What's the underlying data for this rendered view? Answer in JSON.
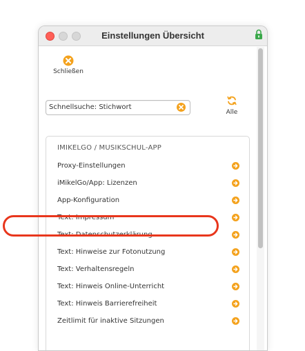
{
  "window": {
    "title": "Einstellungen Übersicht"
  },
  "toolbar": {
    "close_label": "Schließen",
    "close_icon": "close-circle-icon"
  },
  "search": {
    "value": "Schnellsuche: Stichwort",
    "clear_icon": "clear-circle-icon"
  },
  "all_button": {
    "label": "Alle",
    "icon": "refresh-icon"
  },
  "panel": {
    "section_title": "IMIKELGO / MUSIKSCHUL-APP",
    "items": [
      {
        "label": "Proxy-Einstellungen"
      },
      {
        "label": "iMikelGo/App: Lizenzen"
      },
      {
        "label": "App-Konfiguration"
      },
      {
        "label": "Text: Impressum"
      },
      {
        "label": "Text: Datenschutzerklärung"
      },
      {
        "label": "Text: Hinweise zur Fotonutzung"
      },
      {
        "label": "Text: Verhaltensregeln"
      },
      {
        "label": "Text: Hinweis Online-Unterricht"
      },
      {
        "label": "Text: Hinweis Barrierefreiheit"
      },
      {
        "label": "Zeitlimit für inaktive Sitzungen"
      }
    ]
  },
  "colors": {
    "accent": "#f4a21d",
    "highlight": "#e8361c",
    "close_light": "#ff5f57"
  }
}
